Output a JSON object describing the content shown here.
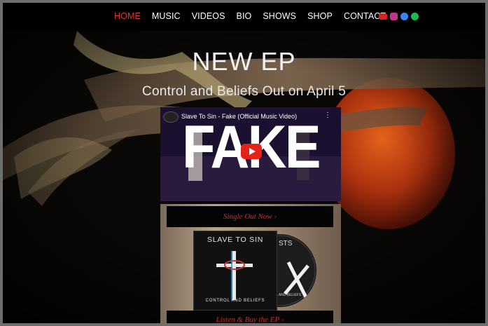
{
  "nav": {
    "items": [
      "HOME",
      "MUSIC",
      "VIDEOS",
      "BIO",
      "SHOWS",
      "SHOP",
      "CONTACT"
    ],
    "active": "HOME"
  },
  "social": [
    {
      "icon": "youtube-icon",
      "color": "#e02020"
    },
    {
      "icon": "instagram-icon",
      "color": "#c13584"
    },
    {
      "icon": "facebook-icon",
      "color": "#3b82f6"
    },
    {
      "icon": "spotify-icon",
      "color": "#1db954"
    }
  ],
  "hero": {
    "title": "NEW EP",
    "subtitle": "Control and Beliefs Out on April 5"
  },
  "video": {
    "title": "Slave To Sin - Fake (Official Music Video)",
    "thumbnail_text": "FAKE"
  },
  "cta": {
    "single": "Single Out Now ›",
    "listen": "Listen & Buy the EP ›"
  },
  "album": {
    "band": "SLAVE TO SIN",
    "title": "CONTROL AND BELIEFS",
    "disc_band": "STS",
    "disc_title": "L AND BELIEFS"
  }
}
